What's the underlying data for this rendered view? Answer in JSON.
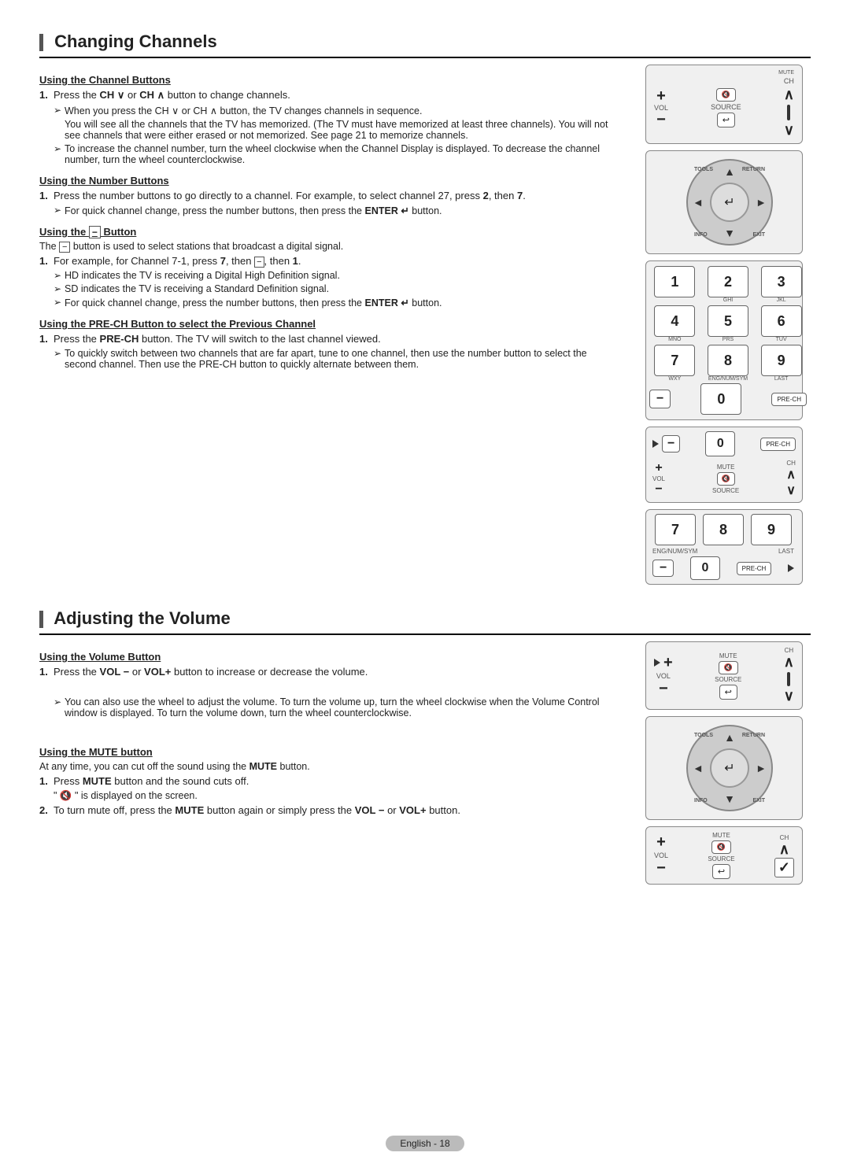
{
  "page": {
    "footer": "English - 18"
  },
  "section1": {
    "title": "Changing Channels",
    "sub1": {
      "heading": "Using the Channel Buttons",
      "item1": "Press the CH ∨ or CH ∧ button to change channels.",
      "bullet1": "When you press the CH ∨ or CH ∧ button, the TV changes channels in sequence.",
      "bullet1b": "You will see all the channels that the TV has memorized. (The TV must have memorized at least three channels). You will not see channels that were either erased or not memorized. See page 21 to memorize channels.",
      "bullet2": "To increase the channel number, turn the wheel clockwise when the Channel Display is displayed. To decrease the channel number, turn the wheel counterclockwise."
    },
    "sub2": {
      "heading": "Using the Number Buttons",
      "item1": "Press the number buttons to go directly to a channel. For example, to select channel 27, press 2, then 7.",
      "bullet1": "For quick channel change, press the number buttons, then press the ENTER ↵ button."
    },
    "sub3": {
      "heading": "Using the − Button",
      "desc": "The − button is used to select stations that broadcast a digital signal.",
      "item1": "For example, for Channel 7-1, press 7, then −, then 1.",
      "bullet1": "HD indicates the TV is receiving a Digital High Definition signal.",
      "bullet2": "SD indicates the TV is receiving a Standard Definition signal.",
      "bullet3": "For quick channel change, press the number buttons, then press the ENTER ↵ button."
    },
    "sub4": {
      "heading": "Using the PRE-CH Button to select the Previous Channel",
      "item1": "Press the PRE-CH button. The TV will switch to the last channel viewed.",
      "bullet1": "To quickly switch between two channels that are far apart, tune to one channel, then use the number button to select the second channel. Then use the PRE-CH button to quickly alternate between them."
    }
  },
  "section2": {
    "title": "Adjusting the Volume",
    "sub1": {
      "heading": "Using the Volume Button",
      "item1": "Press the VOL − or VOL+ button to increase or decrease the volume.",
      "bullet1": "You can also use the wheel to adjust the volume. To turn the volume up, turn the wheel clockwise when the Volume Control window is displayed. To turn the volume down, turn the wheel counterclockwise."
    },
    "sub2": {
      "heading": "Using the MUTE button",
      "desc": "At any time, you can cut off the sound using the MUTE button.",
      "item1": "Press MUTE button and the sound cuts off.",
      "item1b": "\" 🔇 \" is displayed on the screen.",
      "item2": "To turn mute off, press the MUTE button again or simply press the VOL − or VOL+ button."
    }
  },
  "remote": {
    "mute": "MUTE",
    "vol": "VOL",
    "source": "SOURCE",
    "ch": "CH",
    "tools": "TOOLS",
    "return": "RETURN",
    "info": "INFO",
    "exit": "EXIT",
    "pre_ch": "PRE-CH",
    "last": "LAST",
    "eng": "ENG/NUM/SYM",
    "numbers": [
      "1",
      "2",
      "3",
      "4",
      "5",
      "6",
      "7",
      "8",
      "9",
      "0"
    ],
    "sub_labels": [
      "GHI",
      "JKL",
      "MNO",
      "PRS",
      "TUV",
      "WXY",
      "",
      "",
      "",
      ""
    ]
  }
}
